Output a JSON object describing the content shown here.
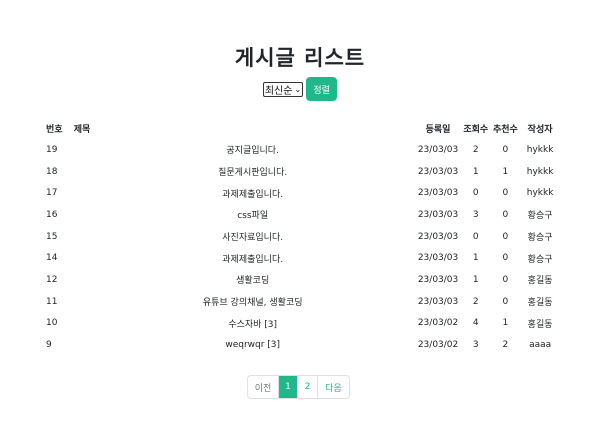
{
  "header": {
    "title": "게시글 리스트"
  },
  "controls": {
    "sort_selected": "최신순",
    "sort_button_label": "정렬"
  },
  "table": {
    "columns": [
      "번호",
      "제목",
      "등록일",
      "조회수",
      "추천수",
      "작성자"
    ],
    "rows": [
      {
        "no": "19",
        "title": "공지글입니다.",
        "date": "23/03/03",
        "views": "2",
        "rec": "0",
        "author": "hykkk"
      },
      {
        "no": "18",
        "title": "질문게시판입니다.",
        "date": "23/03/03",
        "views": "1",
        "rec": "1",
        "author": "hykkk"
      },
      {
        "no": "17",
        "title": "과제제출입니다.",
        "date": "23/03/03",
        "views": "0",
        "rec": "0",
        "author": "hykkk"
      },
      {
        "no": "16",
        "title": "css파일",
        "date": "23/03/03",
        "views": "3",
        "rec": "0",
        "author": "황승구"
      },
      {
        "no": "15",
        "title": "사진자료입니다.",
        "date": "23/03/03",
        "views": "0",
        "rec": "0",
        "author": "황승구"
      },
      {
        "no": "14",
        "title": "과제제출입니다.",
        "date": "23/03/03",
        "views": "1",
        "rec": "0",
        "author": "황승구"
      },
      {
        "no": "12",
        "title": "생활코딩",
        "date": "23/03/03",
        "views": "1",
        "rec": "0",
        "author": "홍길동"
      },
      {
        "no": "11",
        "title": "유튜브 강의채널, 생활코딩",
        "date": "23/03/03",
        "views": "2",
        "rec": "0",
        "author": "홍길동"
      },
      {
        "no": "10",
        "title": "수스자바 [3]",
        "date": "23/03/02",
        "views": "4",
        "rec": "1",
        "author": "홍길동"
      },
      {
        "no": "9",
        "title": "weqrwqr [3]",
        "date": "23/03/02",
        "views": "3",
        "rec": "2",
        "author": "aaaa"
      }
    ]
  },
  "pagination": {
    "prev": "이전",
    "pages": [
      "1",
      "2"
    ],
    "next": "다음",
    "current": "1"
  },
  "colors": {
    "accent": "#20b88a"
  }
}
